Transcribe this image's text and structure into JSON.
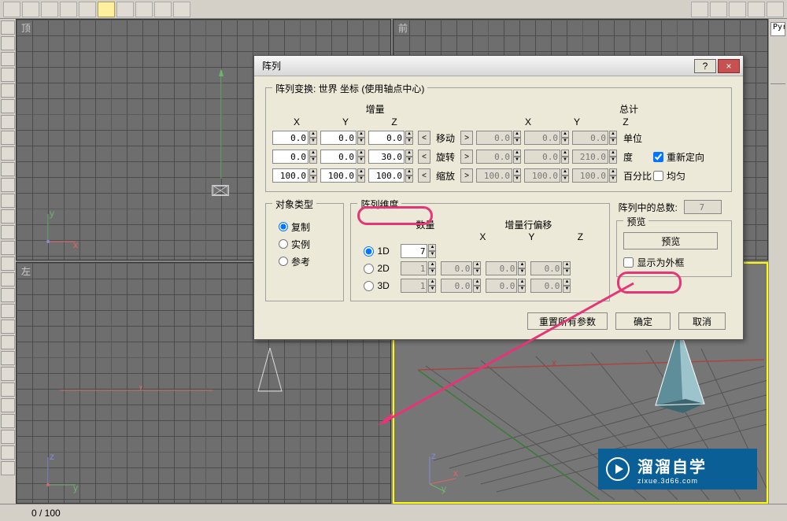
{
  "viewports": {
    "tl": "顶",
    "tr": "前",
    "bl": "左",
    "active": "br"
  },
  "status": {
    "frames": "0  /  100"
  },
  "right_panel_input": "Pyr",
  "dialog": {
    "title": "阵列",
    "help_label": "?",
    "close_label": "×",
    "transform": {
      "title": "阵列变换:  世界  坐标 (使用轴点中心)",
      "increment_label": "增量",
      "total_label": "总计",
      "axes": {
        "x": "X",
        "y": "Y",
        "z": "Z"
      },
      "rows": {
        "move": {
          "label": "移动",
          "unit": "单位",
          "inc": {
            "x": "0.0",
            "y": "0.0",
            "z": "0.0"
          },
          "tot": {
            "x": "0.0",
            "y": "0.0",
            "z": "0.0"
          }
        },
        "rotate": {
          "label": "旋转",
          "unit": "度",
          "inc": {
            "x": "0.0",
            "y": "0.0",
            "z": "30.0"
          },
          "tot": {
            "x": "0.0",
            "y": "0.0",
            "z": "210.0"
          }
        },
        "scale": {
          "label": "缩放",
          "unit": "百分比",
          "inc": {
            "x": "100.0",
            "y": "100.0",
            "z": "100.0"
          },
          "tot": {
            "x": "100.0",
            "y": "100.0",
            "z": "100.0"
          }
        }
      },
      "reorient": {
        "label": "重新定向",
        "checked": true
      },
      "uniform": {
        "label": "均匀",
        "checked": false
      }
    },
    "obj_type": {
      "title": "对象类型",
      "copy": "复制",
      "instance": "实例",
      "reference": "参考",
      "selected": "copy"
    },
    "dim": {
      "title": "阵列维度",
      "count_label": "数量",
      "offset_label": "增量行偏移",
      "axes": {
        "x": "X",
        "y": "Y",
        "z": "Z"
      },
      "d1": {
        "label": "1D",
        "count": "7"
      },
      "d2": {
        "label": "2D",
        "count": "1",
        "x": "0.0",
        "y": "0.0",
        "z": "0.0"
      },
      "d3": {
        "label": "3D",
        "count": "1",
        "x": "0.0",
        "y": "0.0",
        "z": "0.0"
      },
      "selected": "d1"
    },
    "preview": {
      "title": "预览",
      "button": "预览",
      "wireframe": {
        "label": "显示为外框",
        "checked": false
      }
    },
    "total": {
      "label": "阵列中的总数:",
      "value": "7"
    },
    "buttons": {
      "reset": "重置所有参数",
      "ok": "确定",
      "cancel": "取消"
    }
  },
  "watermark": {
    "main": "溜溜自学",
    "sub": "zixue.3d66.com"
  }
}
